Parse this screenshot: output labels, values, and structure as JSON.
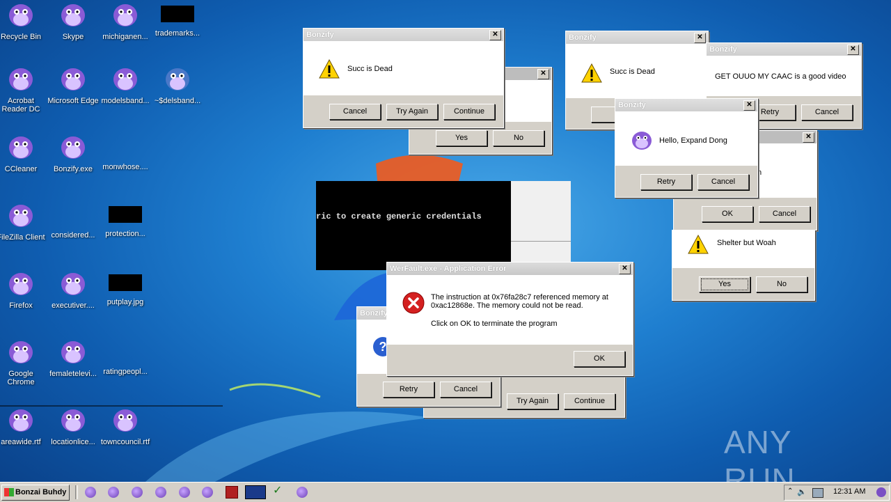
{
  "desktop": {
    "icons": [
      {
        "label": "Recycle Bin",
        "type": "bonzi"
      },
      {
        "label": "Skype",
        "type": "bonzi"
      },
      {
        "label": "michiganen...",
        "type": "bonzi"
      },
      {
        "label": "trademarks...",
        "type": "black"
      },
      {
        "label": "Acrobat Reader DC",
        "type": "bonzi"
      },
      {
        "label": "Microsoft Edge",
        "type": "bonzi"
      },
      {
        "label": "modelsband...",
        "type": "bonzi"
      },
      {
        "label": "~$delsband...",
        "type": "bonzi-blue"
      },
      {
        "label": "CCleaner",
        "type": "bonzi"
      },
      {
        "label": "Bonzify.exe",
        "type": "bonzi"
      },
      {
        "label": "monwhose....",
        "type": "none"
      },
      {
        "label": "FileZilla Client",
        "type": "bonzi"
      },
      {
        "label": "considered...",
        "type": "none"
      },
      {
        "label": "protection...",
        "type": "black"
      },
      {
        "label": "Firefox",
        "type": "bonzi"
      },
      {
        "label": "executiver....",
        "type": "bonzi"
      },
      {
        "label": "putplay.jpg",
        "type": "black"
      },
      {
        "label": "Google Chrome",
        "type": "bonzi"
      },
      {
        "label": "femaletelevi...",
        "type": "bonzi"
      },
      {
        "label": "ratingpeopl...",
        "type": "none"
      },
      {
        "label": "areawide.rtf",
        "type": "bonzi"
      },
      {
        "label": "locationlice...",
        "type": "bonzi"
      },
      {
        "label": "towncouncil.rtf",
        "type": "bonzi"
      }
    ]
  },
  "dialogs": {
    "d1": {
      "title": "Bonzify",
      "message": "Succ is Dead",
      "buttons": [
        "Cancel",
        "Try Again",
        "Continue"
      ]
    },
    "d2": {
      "buttons": [
        "Yes",
        "No"
      ]
    },
    "d3": {
      "title": "Bonzify",
      "message": "Succ is Dead",
      "buttons": [
        ""
      ]
    },
    "d4": {
      "title": "Bonzify",
      "message": "GET OUUO MY CAAC is a good video",
      "buttons": [
        "Retry",
        "Cancel"
      ]
    },
    "d5": {
      "title": "Bonzify",
      "message": "Hello, Expand Dong",
      "buttons": [
        "Retry",
        "Cancel"
      ]
    },
    "d6": {
      "fragment": "n",
      "buttons": [
        "OK",
        "Cancel"
      ]
    },
    "d7": {
      "message": "Shelter but Woah",
      "buttons": [
        "Yes",
        "No"
      ]
    },
    "d8": {
      "title": "Bonzify",
      "buttons": [
        "Retry",
        "Cancel"
      ]
    },
    "d9": {
      "buttons": [
        "Try Again",
        "Continue"
      ]
    },
    "wer": {
      "title": "WerFault.exe - Application Error",
      "line1": "The instruction at 0x76fa28c7 referenced memory at",
      "line2": "0xac12868e. The memory could not be read.",
      "line3": "Click on OK to terminate the program",
      "ok": "OK"
    },
    "console": {
      "text": "ric to create generic credentials"
    }
  },
  "taskbar": {
    "start_label": "Bonzai Buhdy",
    "clock": "12:31 AM"
  },
  "watermark": {
    "text": "ANY RUN"
  },
  "colors": {
    "accent": "#1f7fd0",
    "dialog": "#d4d0c8"
  }
}
